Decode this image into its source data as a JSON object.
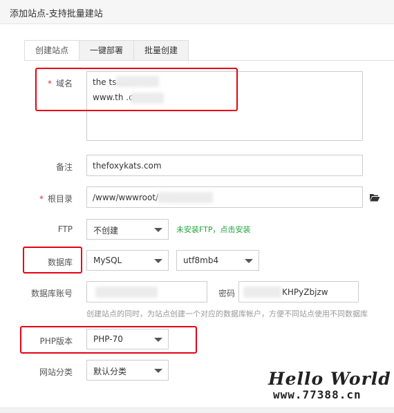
{
  "dialog": {
    "title": "添加站点-支持批量建站"
  },
  "tabs": [
    {
      "label": "创建站点",
      "active": true
    },
    {
      "label": "一键部署",
      "active": false
    },
    {
      "label": "批量创建",
      "active": false
    }
  ],
  "form": {
    "required_mark": "*",
    "domain": {
      "label": "域名",
      "line1": "the       ts.com",
      "line2": "www.th        .com"
    },
    "remark": {
      "label": "备注",
      "value": "thefoxykats.com"
    },
    "root": {
      "label": "根目录",
      "value": "/www/wwwroot/            om"
    },
    "ftp": {
      "label": "FTP",
      "selected": "不创建",
      "link": "未安装FTP，点击安装"
    },
    "database": {
      "label": "数据库",
      "type": "MySQL",
      "charset": "utf8mb4"
    },
    "db_account": {
      "label": "数据库账号",
      "user_value": "",
      "password_label": "密码",
      "password_value": "KHPyZbjzw"
    },
    "hint": "创建站点的同时，为站点创建一个对应的数据库帐户，方便不同站点使用不同数据库",
    "php": {
      "label": "PHP版本",
      "selected": "PHP-70"
    },
    "category": {
      "label": "网站分类",
      "selected": "默认分类"
    }
  },
  "watermark": {
    "line1": "Hello World",
    "line2": "www.77388.cn"
  },
  "colors": {
    "required": "#e03030",
    "link": "#20a53a",
    "annotation": "#e60012"
  }
}
